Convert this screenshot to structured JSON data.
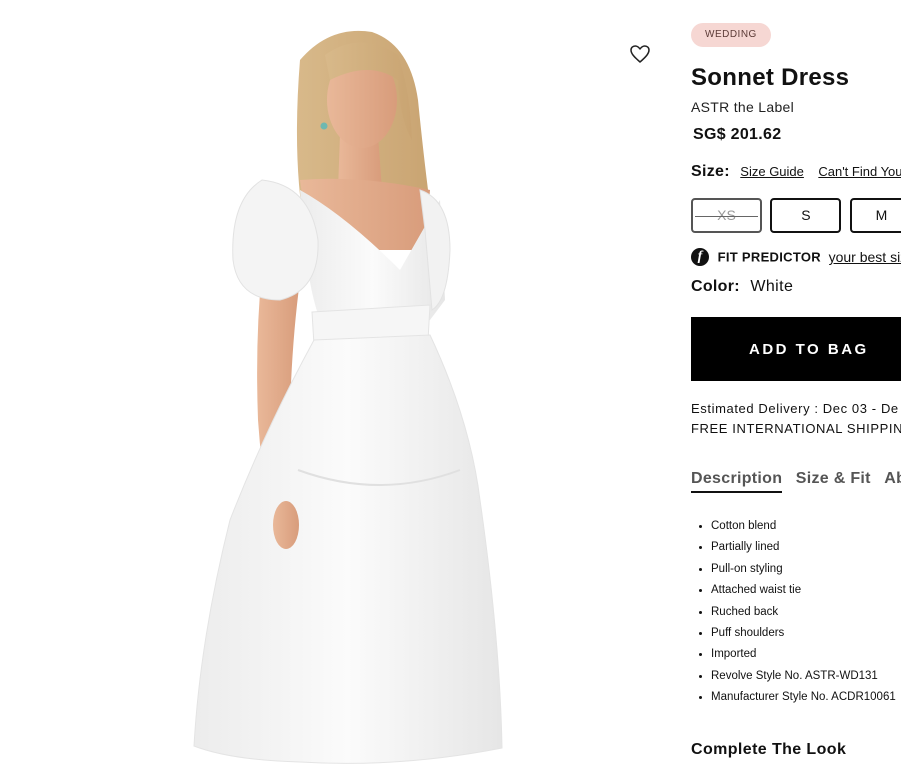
{
  "product": {
    "tag": "WEDDING",
    "name": "Sonnet Dress",
    "brand": "ASTR the Label",
    "price": "SG$ 201.62"
  },
  "size": {
    "label": "Size:",
    "guide_link": "Size Guide",
    "cant_find_link": "Can't Find Your",
    "options": [
      {
        "label": "XS",
        "available": false
      },
      {
        "label": "S",
        "available": true
      },
      {
        "label": "M",
        "available": true
      }
    ]
  },
  "fit_predictor": {
    "logo": "f",
    "label": "FIT PREDICTOR",
    "link": "your best siz"
  },
  "color": {
    "label": "Color:",
    "value": "White"
  },
  "add_to_bag": "ADD TO BAG",
  "delivery": {
    "estimate": "Estimated Delivery : Dec 03 - De",
    "shipping": "FREE INTERNATIONAL SHIPPING"
  },
  "tabs": [
    {
      "label": "Description",
      "active": true
    },
    {
      "label": "Size & Fit",
      "active": false
    },
    {
      "label": "Ab",
      "active": false
    }
  ],
  "description_items": [
    "Cotton blend",
    "Partially lined",
    "Pull-on styling",
    "Attached waist tie",
    "Ruched back",
    "Puff shoulders",
    "Imported",
    "Revolve Style No. ASTR-WD131",
    "Manufacturer Style No. ACDR10061"
  ],
  "complete_the_look": "Complete The Look",
  "icons": {
    "wishlist": "heart-outline-icon"
  },
  "colors": {
    "tag_bg": "#f6d7d3",
    "button_bg": "#000000"
  }
}
